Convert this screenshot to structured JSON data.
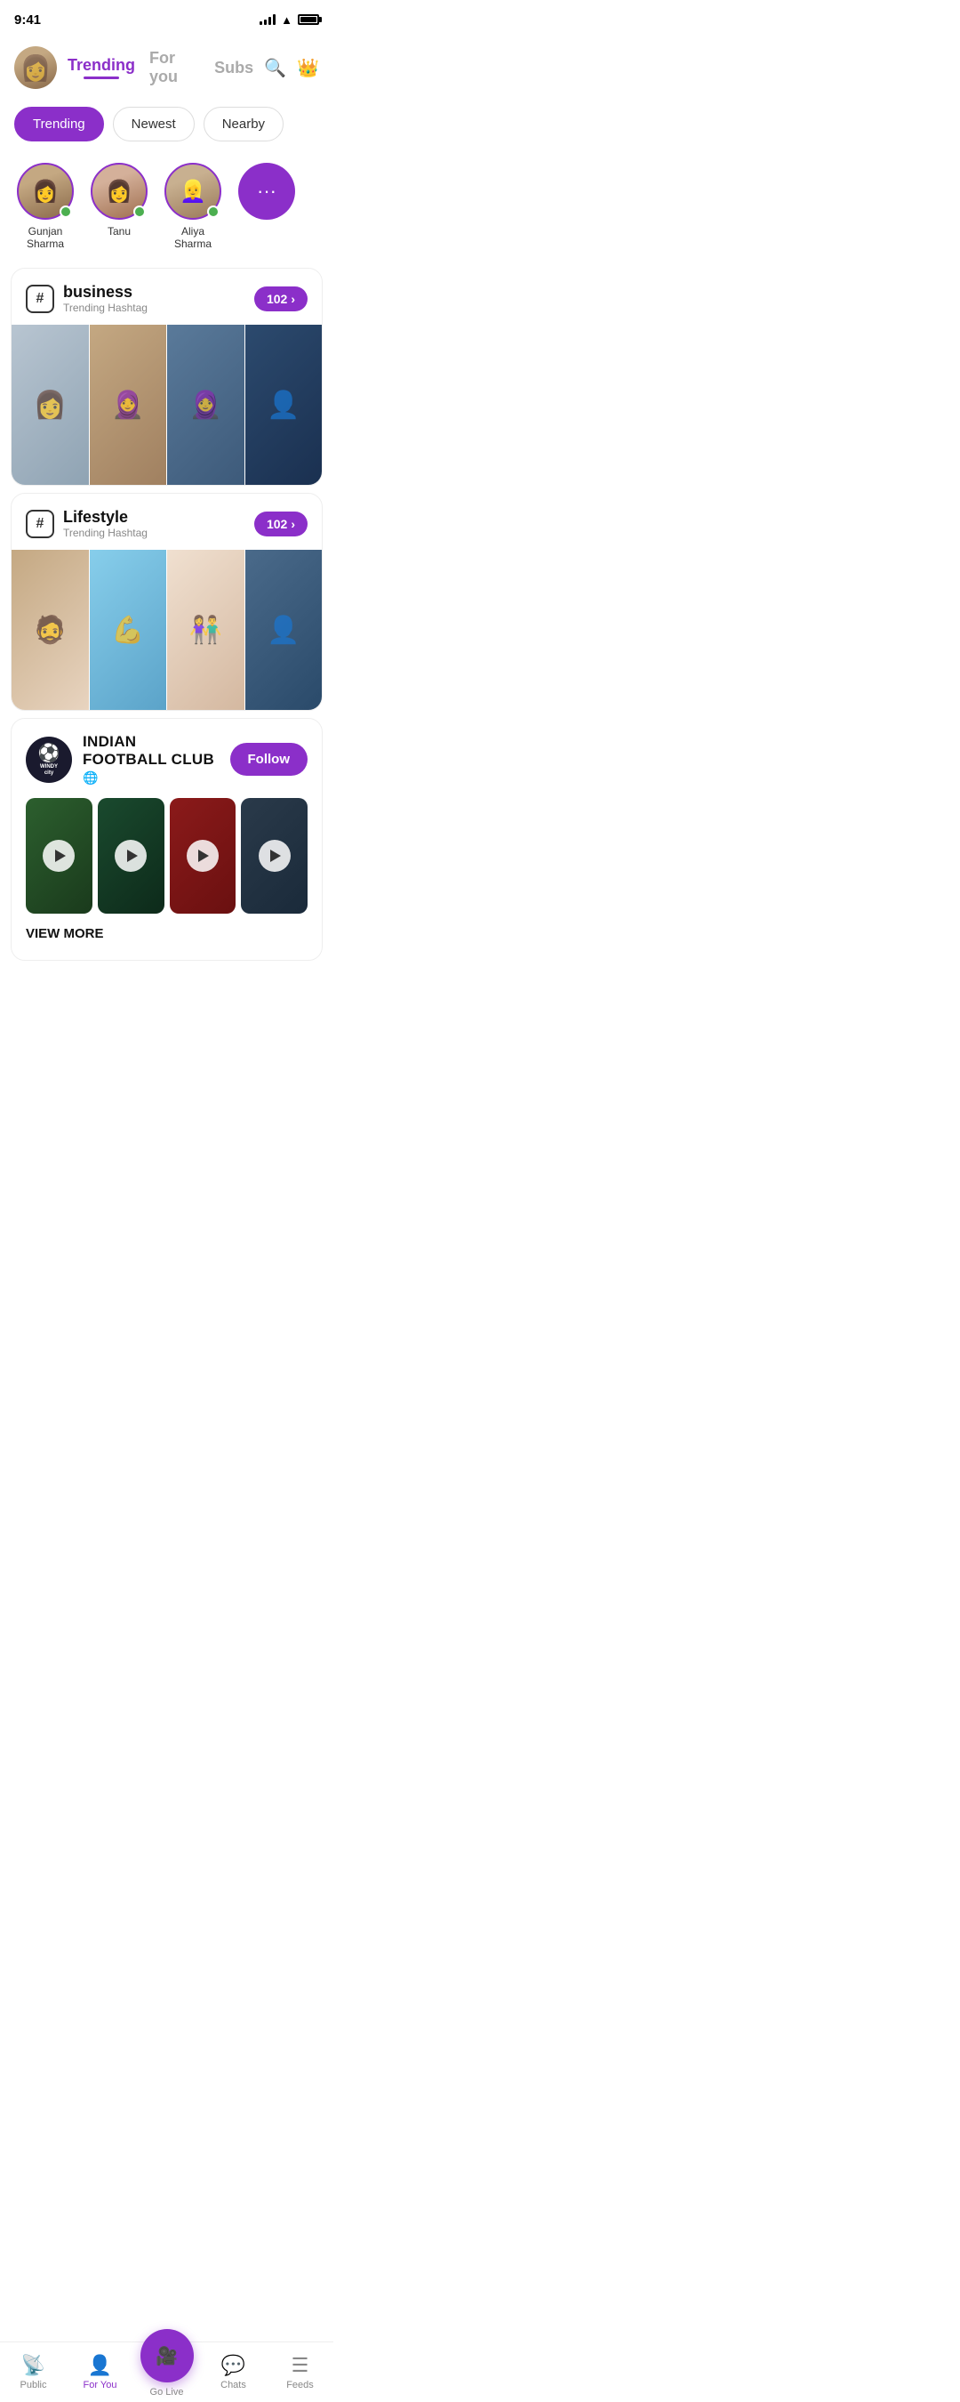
{
  "statusBar": {
    "time": "9:41"
  },
  "header": {
    "tabs": [
      {
        "id": "trending",
        "label": "Trending",
        "active": true
      },
      {
        "id": "for-you",
        "label": "For you",
        "active": false
      },
      {
        "id": "subs",
        "label": "Subs",
        "active": false
      }
    ],
    "searchIcon": "🔍",
    "crownIcon": "👑"
  },
  "filters": [
    {
      "id": "trending",
      "label": "Trending",
      "active": true
    },
    {
      "id": "newest",
      "label": "Newest",
      "active": false
    },
    {
      "id": "nearby",
      "label": "Nearby",
      "active": false
    }
  ],
  "stories": [
    {
      "name": "Gunjan Sharma",
      "online": true
    },
    {
      "name": "Tanu",
      "online": true
    },
    {
      "name": "Aliya Sharma",
      "online": true
    },
    {
      "name": "More",
      "isMore": true
    }
  ],
  "sections": [
    {
      "id": "business",
      "hashTag": "#",
      "title": "business",
      "subtitle": "Trending Hashtag",
      "count": "102",
      "photos": [
        {
          "id": "b1",
          "colorClass": "ph-b1"
        },
        {
          "id": "b2",
          "colorClass": "ph-b2"
        },
        {
          "id": "b3",
          "colorClass": "ph-b3"
        },
        {
          "id": "b4",
          "colorClass": "ph-b4"
        }
      ]
    },
    {
      "id": "lifestyle",
      "hashTag": "#",
      "title": "Lifestyle",
      "subtitle": "Trending Hashtag",
      "count": "102",
      "photos": [
        {
          "id": "l1",
          "colorClass": "ph-l1"
        },
        {
          "id": "l2",
          "colorClass": "ph-l2"
        },
        {
          "id": "l3",
          "colorClass": "ph-l3"
        },
        {
          "id": "l4",
          "colorClass": "ph-l4"
        }
      ]
    }
  ],
  "club": {
    "logoText": "WINDY city\nRAMPAGE",
    "name": "INDIAN FOOTBALL CLUB",
    "type": "🌐",
    "followLabel": "Follow",
    "viewMoreLabel": "VIEW MORE",
    "videos": [
      {
        "id": "cv1",
        "colorClass": "cv1"
      },
      {
        "id": "cv2",
        "colorClass": "cv2"
      },
      {
        "id": "cv3",
        "colorClass": "cv3"
      },
      {
        "id": "cv4",
        "colorClass": "cv4"
      }
    ]
  },
  "bottomNav": [
    {
      "id": "public",
      "label": "Public",
      "icon": "📡",
      "active": false
    },
    {
      "id": "for-you",
      "label": "For You",
      "icon": "👤",
      "active": true
    },
    {
      "id": "go-live",
      "label": "Go Live",
      "icon": "🎥",
      "isCenter": true
    },
    {
      "id": "chats",
      "label": "Chats",
      "icon": "💬",
      "active": false
    },
    {
      "id": "feeds",
      "label": "Feeds",
      "icon": "≡",
      "active": false
    }
  ]
}
